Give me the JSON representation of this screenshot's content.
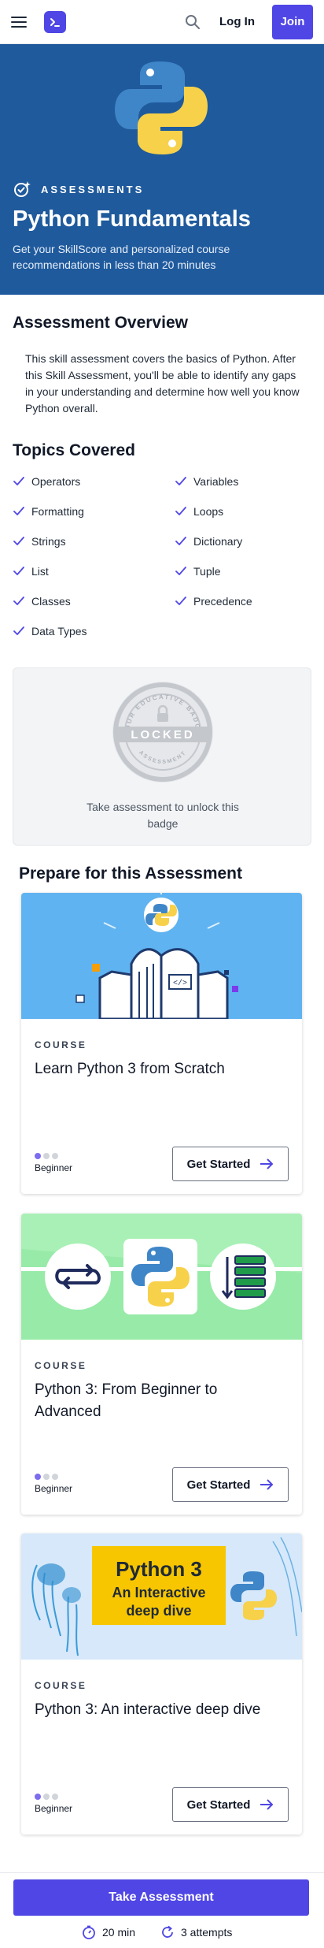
{
  "nav": {
    "menu_icon": "hamburger-icon",
    "logo_icon": "terminal-logo-icon",
    "search_icon": "search-icon",
    "login_label": "Log In",
    "join_label": "Join"
  },
  "hero": {
    "logo": "python-logo",
    "tag_icon": "assessment-badge-icon",
    "tag": "ASSESSMENTS",
    "title": "Python Fundamentals",
    "subtitle": "Get your SkillScore and personalized course recommendations in less than 20 minutes",
    "bg_color": "#1f5a9c"
  },
  "overview": {
    "title": "Assessment Overview",
    "text": "This skill assessment covers the basics of Python. After this Skill Assessment, you'll be able to identify any gaps in your understanding and determine how well you know Python overall."
  },
  "topics": {
    "title": "Topics Covered",
    "items": [
      "Operators",
      "Variables",
      "Formatting",
      "Loops",
      "Strings",
      "Dictionary",
      "List",
      "Tuple",
      "Classes",
      "Precedence",
      "Data Types"
    ]
  },
  "badge": {
    "ring_text_top": "YOUR EDUCATIVE BADGE",
    "ring_text_bottom": "ASSESSMENT",
    "status": "LOCKED",
    "unlock_text": "Take assessment to unlock this badge"
  },
  "prepare": {
    "title": "Prepare for this Assessment",
    "courses": [
      {
        "kind": "COURSE",
        "title": "Learn Python 3 from Scratch",
        "level": "Beginner",
        "level_value": 1,
        "level_max": 3,
        "cta": "Get Started"
      },
      {
        "kind": "COURSE",
        "title": "Python 3: From Beginner to Advanced",
        "level": "Beginner",
        "level_value": 1,
        "level_max": 3,
        "cta": "Get Started"
      },
      {
        "kind": "COURSE",
        "title": "Python 3: An interactive deep dive",
        "level": "Beginner",
        "level_value": 1,
        "level_max": 3,
        "cta": "Get Started",
        "thumb_text": [
          "Python 3",
          "An Interactive",
          "deep dive"
        ]
      }
    ]
  },
  "footer": {
    "take_label": "Take Assessment",
    "duration": "20 min",
    "attempts": "3 attempts",
    "accent": "#4f46e5"
  }
}
